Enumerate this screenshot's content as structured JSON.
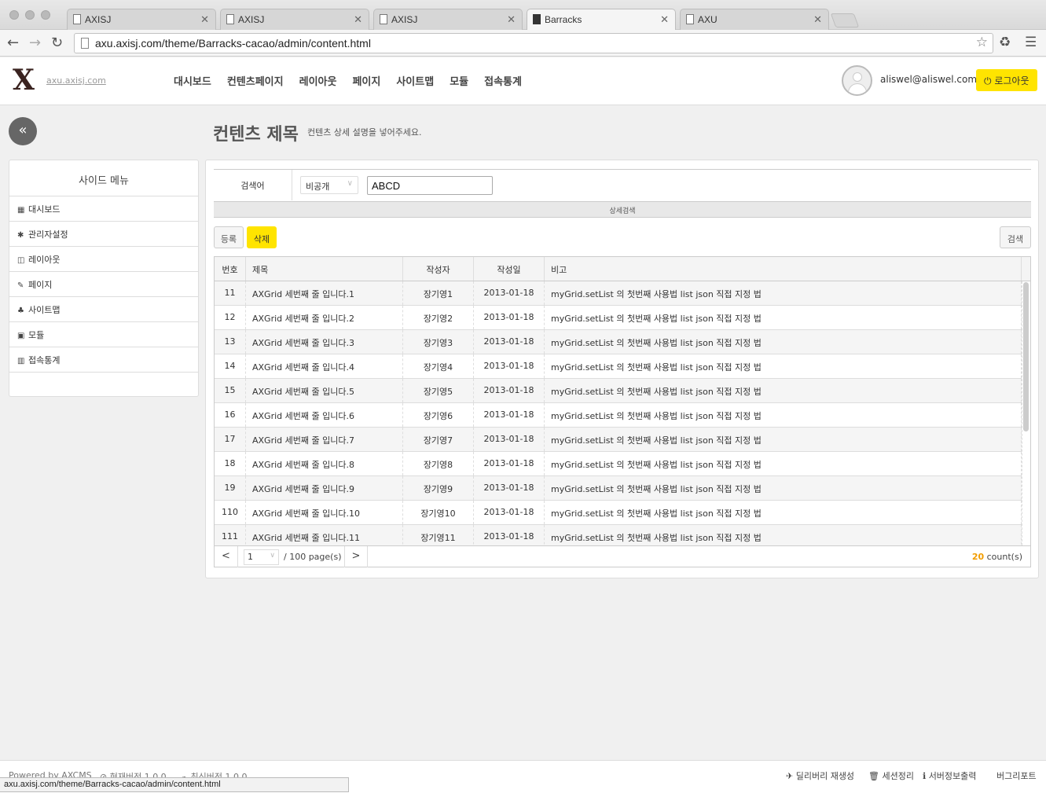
{
  "browser": {
    "tabs": [
      "AXISJ",
      "AXISJ",
      "AXISJ",
      "Barracks",
      "AXU"
    ],
    "active_tab": 3,
    "url": "axu.axisj.com/theme/Barracks-cacao/admin/content.html",
    "status_url": "axu.axisj.com/theme/Barracks-cacao/admin/content.html"
  },
  "header": {
    "logo_text": "X",
    "site_link": "axu.axisj.com",
    "nav": [
      "대시보드",
      "컨텐츠페이지",
      "레이아웃",
      "페이지",
      "사이트맵",
      "모듈",
      "접속통계"
    ],
    "user_email": "aliswel@aliswel.com",
    "logout_label": "로그아웃"
  },
  "page": {
    "collapse_glyph": "«",
    "title": "컨텐츠 제목",
    "description": "컨텐츠 상세 설명을 넣어주세요."
  },
  "sidebar": {
    "title": "사이드 메뉴",
    "items": [
      {
        "icon": "▦",
        "label": "대시보드"
      },
      {
        "icon": "✱",
        "label": "관리자설정"
      },
      {
        "icon": "◫",
        "label": "레이아웃"
      },
      {
        "icon": "✎",
        "label": "페이지"
      },
      {
        "icon": "♣",
        "label": "사이트맵"
      },
      {
        "icon": "▣",
        "label": "모듈"
      },
      {
        "icon": "▥",
        "label": "접속통계"
      }
    ]
  },
  "search": {
    "label": "검색어",
    "select_value": "비공개",
    "input_value": "ABCD",
    "detail_label": "상세검색",
    "register_label": "등록",
    "delete_label": "삭제",
    "search_label": "검색"
  },
  "grid": {
    "columns": [
      "번호",
      "제목",
      "작성자",
      "작성일",
      "비고"
    ],
    "rows": [
      [
        "11",
        "AXGrid 세번째 줄 입니다.1",
        "장기영1",
        "2013-01-18",
        "myGrid.setList 의 첫번째 사용법 list json 직접 지정 법"
      ],
      [
        "12",
        "AXGrid 세번째 줄 입니다.2",
        "장기영2",
        "2013-01-18",
        "myGrid.setList 의 첫번째 사용법 list json 직접 지정 법"
      ],
      [
        "13",
        "AXGrid 세번째 줄 입니다.3",
        "장기영3",
        "2013-01-18",
        "myGrid.setList 의 첫번째 사용법 list json 직접 지정 법"
      ],
      [
        "14",
        "AXGrid 세번째 줄 입니다.4",
        "장기영4",
        "2013-01-18",
        "myGrid.setList 의 첫번째 사용법 list json 직접 지정 법"
      ],
      [
        "15",
        "AXGrid 세번째 줄 입니다.5",
        "장기영5",
        "2013-01-18",
        "myGrid.setList 의 첫번째 사용법 list json 직접 지정 법"
      ],
      [
        "16",
        "AXGrid 세번째 줄 입니다.6",
        "장기영6",
        "2013-01-18",
        "myGrid.setList 의 첫번째 사용법 list json 직접 지정 법"
      ],
      [
        "17",
        "AXGrid 세번째 줄 입니다.7",
        "장기영7",
        "2013-01-18",
        "myGrid.setList 의 첫번째 사용법 list json 직접 지정 법"
      ],
      [
        "18",
        "AXGrid 세번째 줄 입니다.8",
        "장기영8",
        "2013-01-18",
        "myGrid.setList 의 첫번째 사용법 list json 직접 지정 법"
      ],
      [
        "19",
        "AXGrid 세번째 줄 입니다.9",
        "장기영9",
        "2013-01-18",
        "myGrid.setList 의 첫번째 사용법 list json 직접 지정 법"
      ],
      [
        "110",
        "AXGrid 세번째 줄 입니다.10",
        "장기영10",
        "2013-01-18",
        "myGrid.setList 의 첫번째 사용법 list json 직접 지정 법"
      ],
      [
        "111",
        "AXGrid 세번째 줄 입니다.11",
        "장기영11",
        "2013-01-18",
        "myGrid.setList 의 첫번째 사용법 list json 직접 지정 법"
      ]
    ],
    "pager": {
      "prev": "<",
      "next": ">",
      "page_value": "1",
      "total_pages": "/ 100 page(s)",
      "count_value": "20",
      "count_suffix": " count(s)"
    }
  },
  "footer": {
    "powered": "Powered by AXCMS",
    "current_version": "현재버전 1.0.0",
    "latest_version": "최신버전 1.0.0",
    "links": [
      "딜리버리 재생성",
      "세션정리",
      "서버정보출력",
      "버그리포트"
    ]
  },
  "colors": {
    "accent_yellow": "#ffe400",
    "count_orange": "#f29d00"
  }
}
